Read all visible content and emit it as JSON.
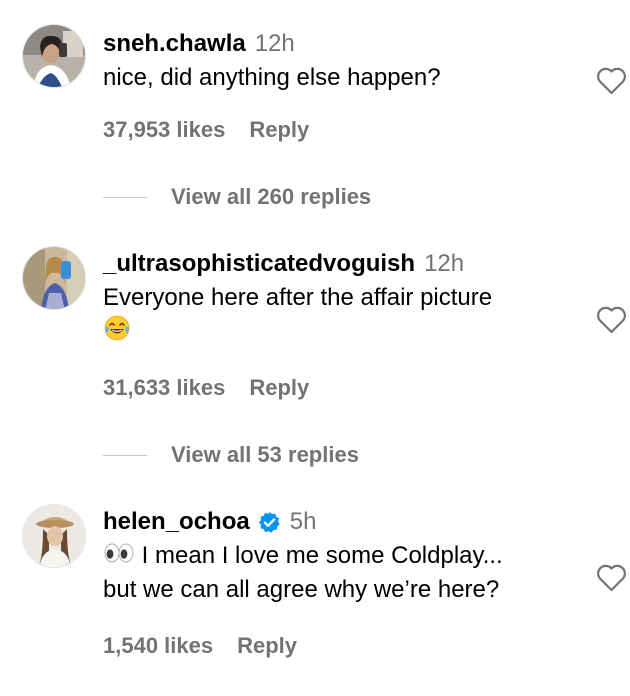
{
  "comments": [
    {
      "username": "sneh.chawla",
      "time": "12h",
      "text": "nice, did anything else happen?",
      "likes": "37,953 likes",
      "reply_label": "Reply",
      "view_replies": "View all 260 replies",
      "verified": false
    },
    {
      "username": "_ultrasophisticatedvoguish",
      "time": "12h",
      "text": "Everyone here after the affair picture",
      "emoji": "face-with-tears-of-joy",
      "likes": "31,633 likes",
      "reply_label": "Reply",
      "view_replies": "View all 53 replies",
      "verified": false
    },
    {
      "username": "helen_ochoa",
      "time": "5h",
      "text_line1": "I mean I love me some Coldplay...",
      "text_line2": "but we can all agree why we’re here?",
      "emoji": "eyes",
      "likes": "1,540 likes",
      "reply_label": "Reply",
      "verified": true
    }
  ],
  "colors": {
    "primary_text": "#000000",
    "secondary_text": "#737373",
    "verified_badge": "#0095f6",
    "divider": "#c8c8c8"
  },
  "icons": {
    "like": "heart-outline-icon",
    "verified": "verified-badge-icon"
  }
}
